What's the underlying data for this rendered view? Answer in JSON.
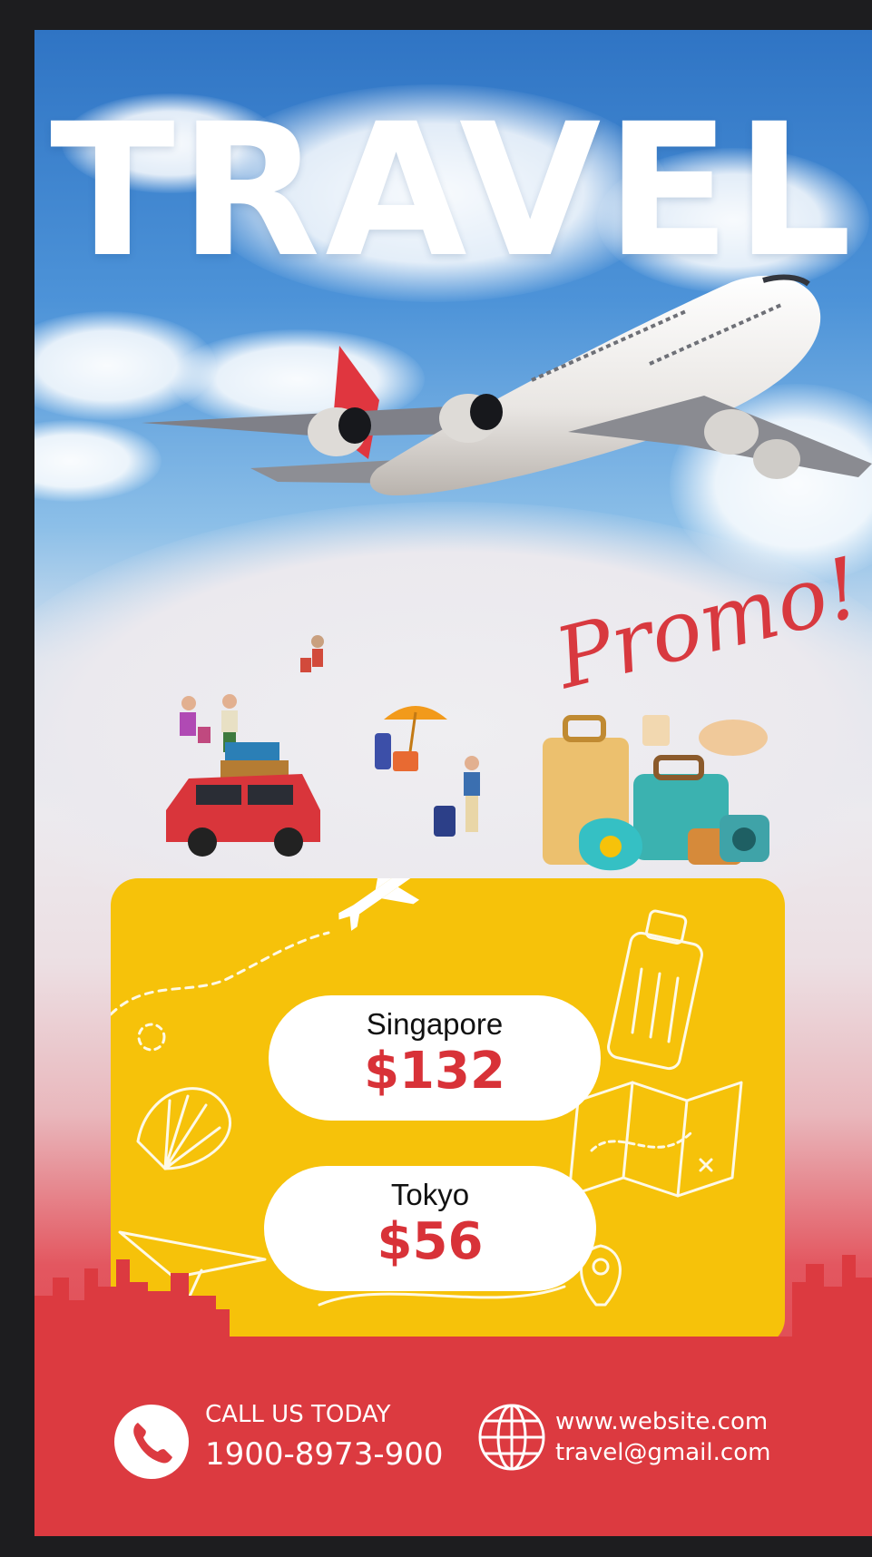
{
  "poster": {
    "headline": "TRAVEL",
    "promo_tag": "Promo!",
    "deals": [
      {
        "city": "Singapore",
        "price": "$132"
      },
      {
        "city": "Tokyo",
        "price": "$56"
      }
    ],
    "contact": {
      "call_label": "CALL US TODAY",
      "phone": "1900-8973-900",
      "website": "www.website.com",
      "email": "travel@gmail.com"
    }
  },
  "icons": [
    "airplane-icon",
    "phone-icon",
    "globe-icon",
    "suitcase-icon",
    "map-icon",
    "shell-icon",
    "location-pin-icon",
    "paper-plane-icon"
  ],
  "colors": {
    "sky_blue": "#2f74c4",
    "promo_red": "#d8393f",
    "panel_yellow": "#f6c20a",
    "footer_red": "#dc3a40",
    "white": "#ffffff"
  }
}
